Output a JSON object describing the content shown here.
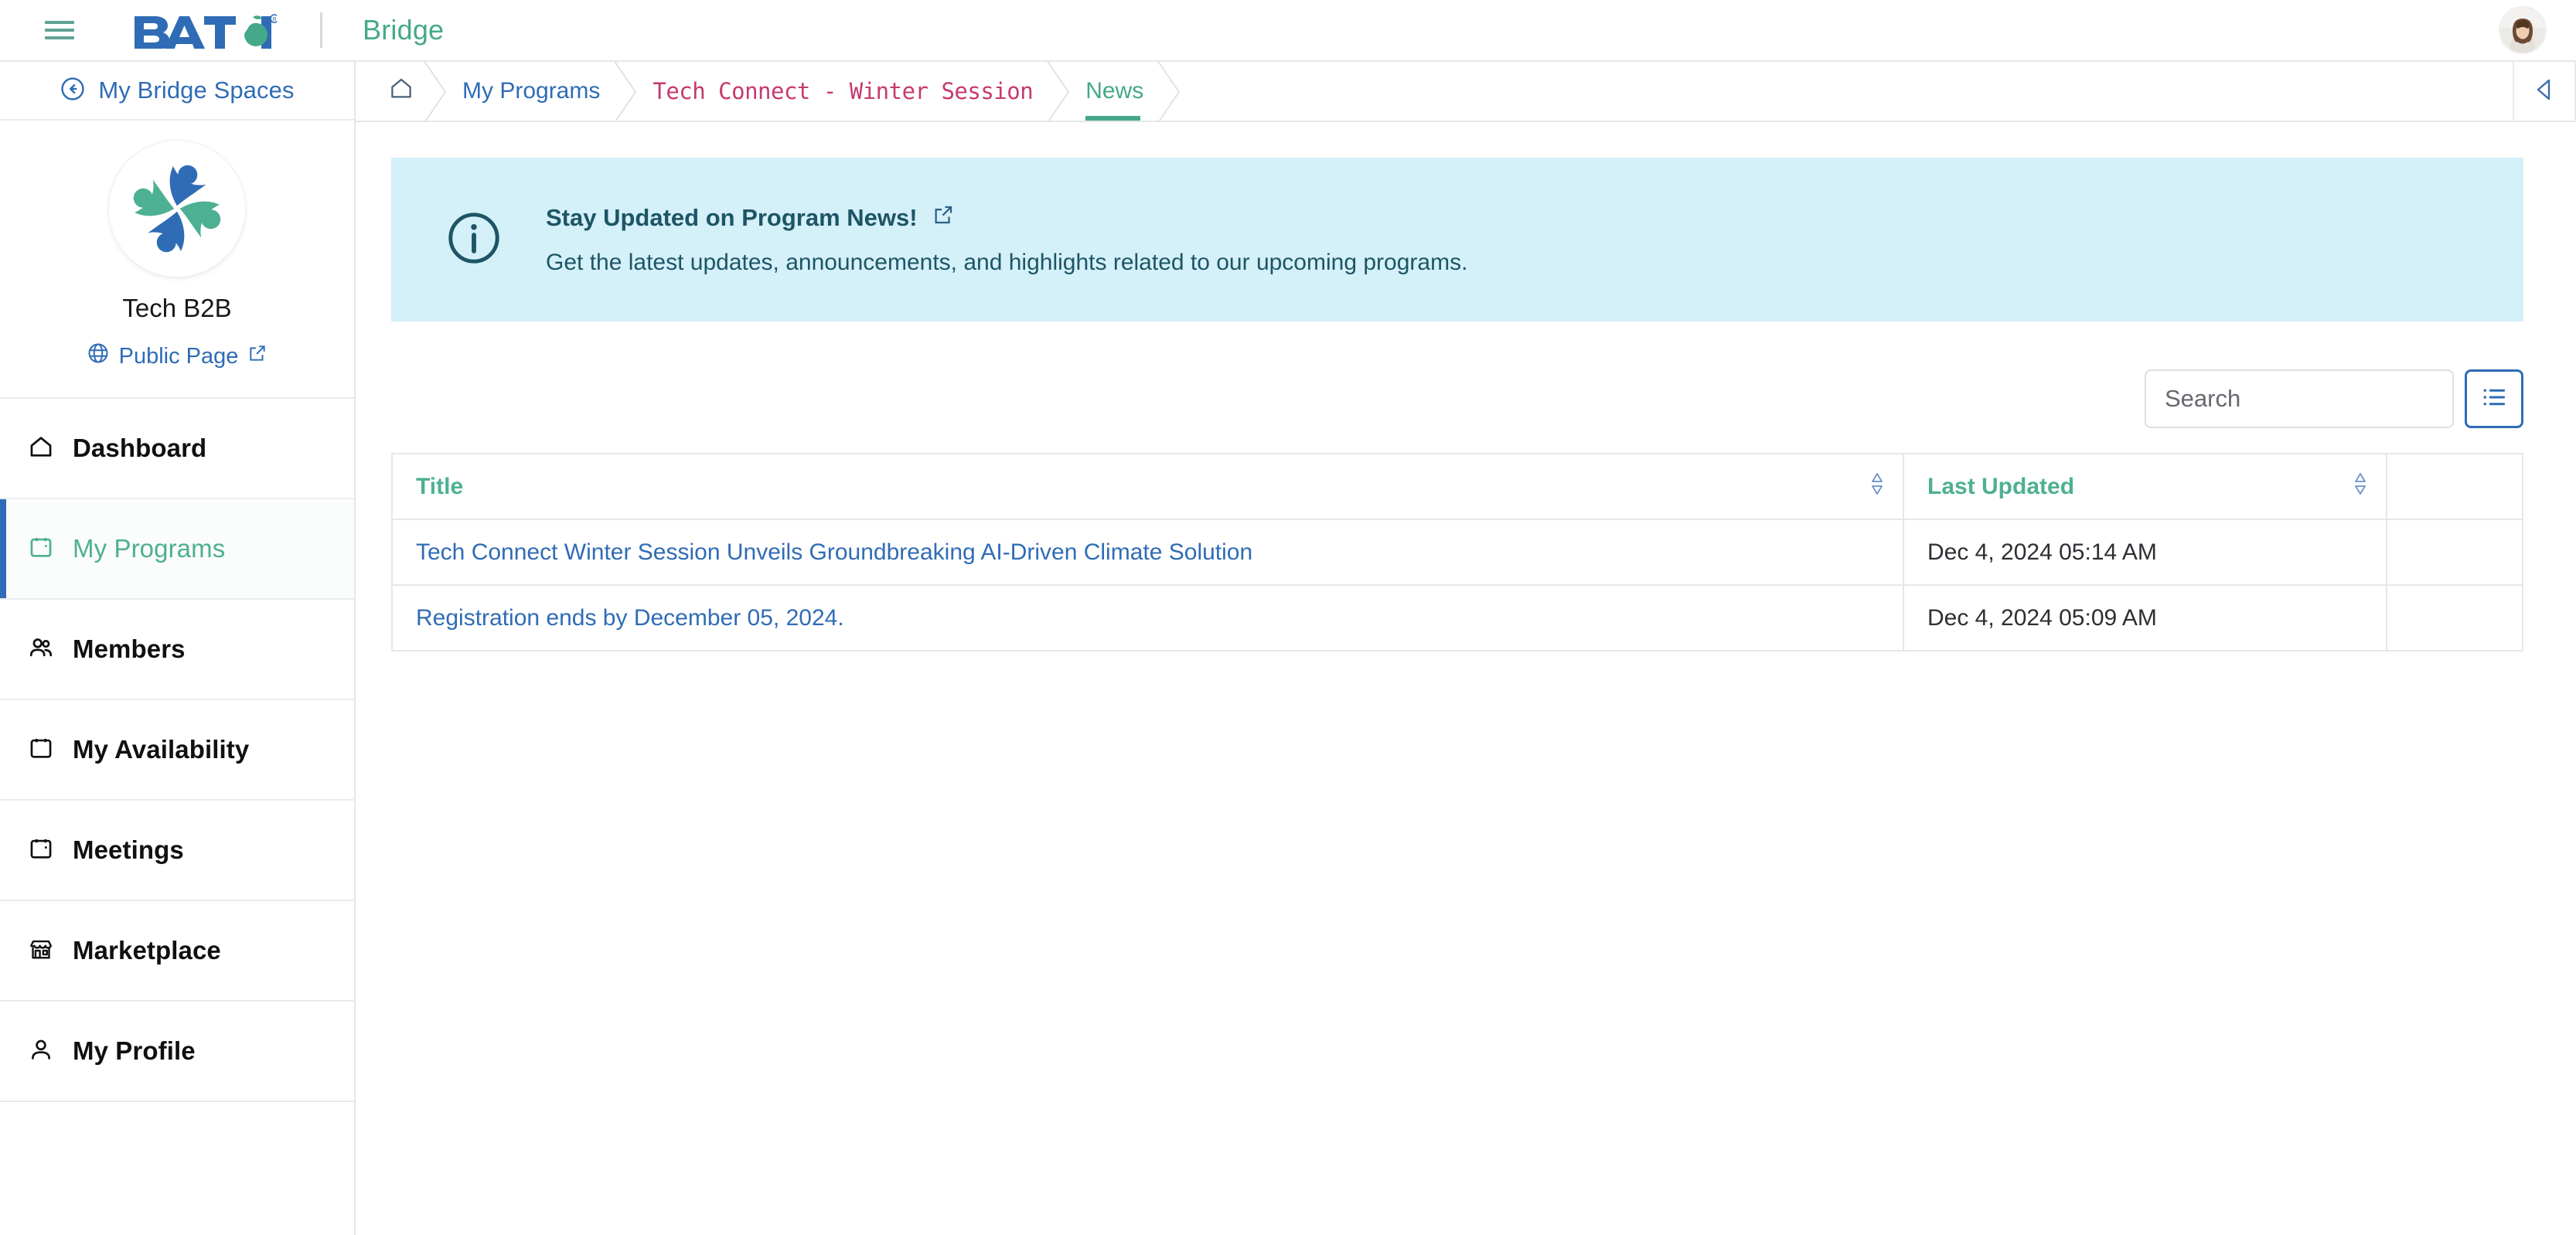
{
  "topbar": {
    "menu_icon": "hamburger-icon",
    "brand_name": "BATOI",
    "brand_registered": "®",
    "product_name": "Bridge",
    "avatar_icon": "user-avatar"
  },
  "sidebar": {
    "back_link": {
      "label": "My Bridge Spaces",
      "icon": "arrow-left-circle-icon"
    },
    "space": {
      "logo_icon": "tech-b2b-pinwheel-logo",
      "name": "Tech B2B",
      "public_page_label": "Public Page",
      "public_page_icon": "globe-icon",
      "public_page_external_icon": "external-link-icon"
    },
    "items": [
      {
        "label": "Dashboard",
        "icon": "home-icon",
        "active": false
      },
      {
        "label": "My Programs",
        "icon": "calendar-icon",
        "active": true
      },
      {
        "label": "Members",
        "icon": "users-icon",
        "active": false
      },
      {
        "label": "My Availability",
        "icon": "calendar-icon",
        "active": false
      },
      {
        "label": "Meetings",
        "icon": "calendar-icon",
        "active": false
      },
      {
        "label": "Marketplace",
        "icon": "storefront-icon",
        "active": false
      },
      {
        "label": "My Profile",
        "icon": "person-icon",
        "active": false
      }
    ]
  },
  "breadcrumb": {
    "home_icon": "home-icon",
    "items": [
      {
        "label": "My Programs"
      },
      {
        "label": "Tech Connect - Winter Session"
      },
      {
        "label": "News"
      }
    ],
    "collapse_icon": "triangle-left-icon"
  },
  "banner": {
    "icon": "info-circle-icon",
    "title": "Stay Updated on Program News!",
    "title_external_icon": "external-link-icon",
    "description": "Get the latest updates, announcements, and highlights related to our upcoming programs."
  },
  "toolbar": {
    "search_placeholder": "Search",
    "search_value": "",
    "list_view_icon": "list-icon"
  },
  "table": {
    "columns": [
      {
        "label": "Title",
        "sortable": true,
        "sort_icon": "sort-updown-icon"
      },
      {
        "label": "Last Updated",
        "sortable": true,
        "sort_icon": "sort-updown-icon"
      },
      {
        "label": "",
        "sortable": false,
        "sort_icon": ""
      }
    ],
    "rows": [
      {
        "title": "Tech Connect Winter Session Unveils Groundbreaking AI-Driven Climate Solution",
        "last_updated": "Dec 4, 2024 05:14 AM",
        "actions": ""
      },
      {
        "title": "Registration ends by December 05, 2024.",
        "last_updated": "Dec 4, 2024 05:09 AM",
        "actions": ""
      }
    ]
  },
  "colors": {
    "brand_blue": "#2f6cb5",
    "brand_green": "#45a88b",
    "accent_green": "#4db092",
    "crumb_pink": "#c6396f",
    "banner_bg": "#d4f0f9",
    "banner_fg": "#1d5565",
    "border": "#e4e7ea"
  }
}
